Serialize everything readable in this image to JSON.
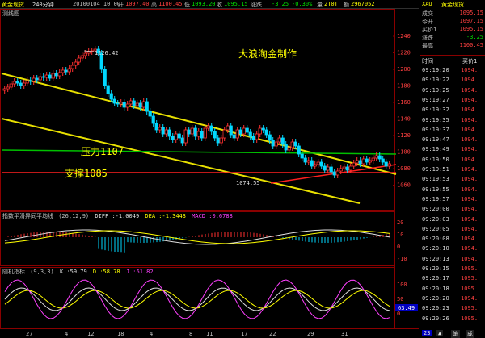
{
  "header": {
    "instrument": "黄金现货",
    "period": "240分钟",
    "datetime": "20100104 10:00",
    "open_label": "开",
    "open": "1097.40",
    "high_label": "高",
    "high": "1100.45",
    "low_label": "低",
    "low": "1093.20",
    "close_label": "收",
    "close": "1095.15",
    "change_label": "涨跌",
    "change": "-3.25",
    "change_pct": "-0.30%",
    "volume_label": "量",
    "volume": "2T0T",
    "amount_label": "额",
    "amount": "2967052"
  },
  "main_chart": {
    "mode_label": "测线图",
    "annotation_title": "大浪淘金制作",
    "resistance_label": "压力1107",
    "support_label": "支撑1085",
    "high_marker": "1226.42",
    "low_marker": "1074.55",
    "y_ticks": [
      "1240",
      "1220",
      "1200",
      "1180",
      "1160",
      "1140",
      "1120",
      "1100",
      "1080",
      "1060"
    ],
    "colors": {
      "up": "#ff3030",
      "down": "#00d8ff",
      "channel": "#e8e000",
      "resistance": "#00c000",
      "support": "#ff2020",
      "annotation": "#ffff00"
    }
  },
  "macd": {
    "title": "指数平滑异同平均线",
    "params": "(26,12,9)",
    "diff_label": "DIFF",
    "diff": ":-1.0049",
    "dea_label": "DEA",
    "dea": ":-1.3443",
    "macd_label": "MACD",
    "macd": ":0.6788",
    "y_ticks": [
      "20",
      "10",
      "0",
      "-10"
    ]
  },
  "kdj": {
    "title": "随机指标",
    "params": "(9,3,3)",
    "k_label": "K",
    "k": ":59.79",
    "d_label": "D",
    "d": ":58.78",
    "j_label": "J",
    "j": ":61.82",
    "y_ticks": [
      "100",
      "50",
      "0"
    ],
    "current_value": "63.49"
  },
  "x_axis": {
    "labels": [
      "27",
      "4",
      "12",
      "18",
      "4",
      "8",
      "11",
      "17",
      "22",
      "29",
      "31"
    ]
  },
  "right_panel": {
    "symbol": "XAU",
    "name": "黄金现货",
    "quote_rows": [
      {
        "label": "成交",
        "value": "1095.15",
        "color": "#ff4040"
      },
      {
        "label": "今开",
        "value": "1097.15",
        "color": "#ff4040"
      },
      {
        "label": "买价1",
        "value": "1095.15",
        "color": "#ff4040"
      },
      {
        "label": "涨跌",
        "value": "-3.25",
        "color": "#00e000"
      },
      {
        "label": "最高",
        "value": "1100.45",
        "color": "#ff4040"
      }
    ],
    "time_header": "时间",
    "price_header": "买价1",
    "ticks": [
      {
        "time": "09:19:20",
        "price": "1094."
      },
      {
        "time": "09:19:22",
        "price": "1094."
      },
      {
        "time": "09:19:25",
        "price": "1094."
      },
      {
        "time": "09:19:27",
        "price": "1094."
      },
      {
        "time": "09:19:32",
        "price": "1094."
      },
      {
        "time": "09:19:35",
        "price": "1094."
      },
      {
        "time": "09:19:37",
        "price": "1094."
      },
      {
        "time": "09:19:47",
        "price": "1094."
      },
      {
        "time": "09:19:49",
        "price": "1094."
      },
      {
        "time": "09:19:50",
        "price": "1094."
      },
      {
        "time": "09:19:51",
        "price": "1094."
      },
      {
        "time": "09:19:53",
        "price": "1094."
      },
      {
        "time": "09:19:55",
        "price": "1094."
      },
      {
        "time": "09:19:57",
        "price": "1094."
      },
      {
        "time": "09:20:00",
        "price": "1094."
      },
      {
        "time": "09:20:03",
        "price": "1094."
      },
      {
        "time": "09:20:05",
        "price": "1094."
      },
      {
        "time": "09:20:08",
        "price": "1094."
      },
      {
        "time": "09:20:10",
        "price": "1094."
      },
      {
        "time": "09:20:13",
        "price": "1094."
      },
      {
        "time": "09:20:15",
        "price": "1095."
      },
      {
        "time": "09:20:17",
        "price": "1095."
      },
      {
        "time": "09:20:18",
        "price": "1095."
      },
      {
        "time": "09:20:20",
        "price": "1094."
      },
      {
        "time": "09:20:23",
        "price": "1095."
      },
      {
        "time": "09:20:26",
        "price": "1095."
      }
    ],
    "footer_tabs": [
      "23",
      "▲",
      "笔",
      "成"
    ]
  }
}
